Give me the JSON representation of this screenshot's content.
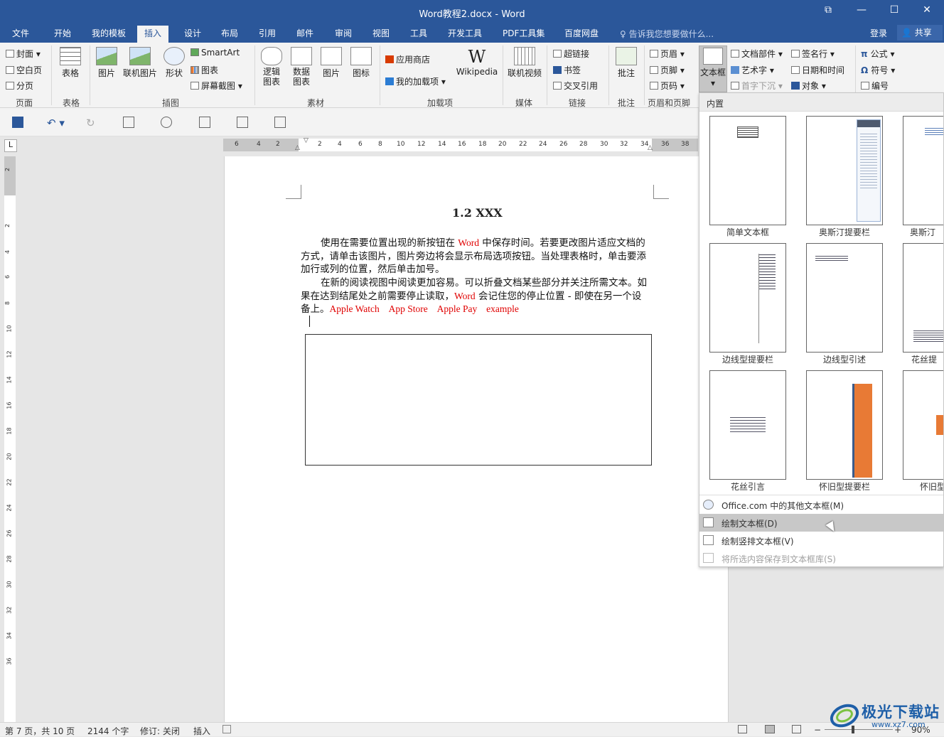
{
  "window": {
    "title": "Word教程2.docx - Word"
  },
  "menu": {
    "tabs": [
      "文件",
      "开始",
      "我的模板",
      "插入",
      "设计",
      "布局",
      "引用",
      "邮件",
      "审阅",
      "视图",
      "工具",
      "开发工具",
      "PDF工具集",
      "百度网盘"
    ],
    "active_tab": "插入",
    "tell_me": "告诉我您想要做什么...",
    "login": "登录",
    "share": "共享"
  },
  "ribbon": {
    "page_group": {
      "items": [
        "封面",
        "空白页",
        "分页"
      ],
      "label": "页面"
    },
    "table_group": {
      "button": "表格",
      "label": "表格"
    },
    "illustrations": {
      "picture": "图片",
      "online_picture": "联机图片",
      "shapes": "形状",
      "smartart": "SmartArt",
      "chart": "图表",
      "screenshot": "屏幕截图",
      "label": "插图"
    },
    "material": {
      "logic": [
        "逻辑",
        "图表"
      ],
      "data": [
        "数据",
        "图表"
      ],
      "picture": "图片",
      "icon": "图标",
      "label": "素材"
    },
    "addins": {
      "store": "应用商店",
      "my_addins": "我的加载项",
      "wikipedia": "Wikipedia",
      "label": "加载项"
    },
    "media": {
      "video": "联机视频",
      "label": "媒体"
    },
    "links": {
      "hyperlink": "超链接",
      "bookmark": "书签",
      "cross_ref": "交叉引用",
      "label": "链接"
    },
    "comments": {
      "comment": "批注",
      "label": "批注"
    },
    "header_footer": {
      "header": "页眉",
      "footer": "页脚",
      "page_number": "页码",
      "label": "页眉和页脚"
    },
    "text": {
      "textbox": "文本框",
      "parts": "文档部件",
      "wordart": "艺术字",
      "dropcap": "首字下沉",
      "signature": "签名行",
      "datetime": "日期和时间",
      "object": "对象"
    },
    "symbols": {
      "equation": "公式",
      "symbol": "符号",
      "number": "编号"
    }
  },
  "ruler": {
    "h_left": [
      "6",
      "4",
      "2"
    ],
    "h_main": [
      "2",
      "4",
      "6",
      "8",
      "10",
      "12",
      "14",
      "16",
      "18",
      "20",
      "22",
      "24",
      "26",
      "28",
      "30",
      "32",
      "34",
      "36",
      "38"
    ],
    "v": [
      "2",
      "2",
      "4",
      "6",
      "8",
      "10",
      "12",
      "14",
      "16",
      "18",
      "20",
      "22",
      "24",
      "26",
      "28",
      "30",
      "32",
      "34",
      "36"
    ],
    "corner": "L"
  },
  "document": {
    "heading": "1.2 XXX",
    "p1": {
      "a": "使用在需要位置出现的新按钮在 ",
      "word": "Word",
      "b": " 中保存时间。若要更改图片适应文档的方式，请单击该图片，图片旁边将会显示布局选项按钮。当处理表格时，单击要添加行或列的位置，然后单击加号。"
    },
    "p2": {
      "a": "在新的阅读视图中阅读更加容易。可以折叠文档某些部分并关注所需文本。如果在达到结尾处之前需要停止读取，",
      "word": "Word",
      "b": " 会记住您的停止位置 - 即使在另一个设备上。",
      "r1": "Apple Watch",
      "r2": "App Store",
      "r3": "Apple Pay",
      "r4": "example"
    }
  },
  "gallery": {
    "header": "内置",
    "captions": [
      "简单文本框",
      "奥斯汀提要栏",
      "奥斯汀",
      "边线型提要栏",
      "边线型引述",
      "花丝提",
      "花丝引言",
      "怀旧型提要栏",
      "怀旧型"
    ],
    "menu": [
      "Office.com 中的其他文本框(M)",
      "绘制文本框(D)",
      "绘制竖排文本框(V)",
      "将所选内容保存到文本框库(S)"
    ]
  },
  "status": {
    "page": "第 7 页，共 10 页",
    "words": "2144 个字",
    "track": "修订: 关闭",
    "mode": "插入",
    "zoom": "90%"
  },
  "watermark": {
    "text": "极光下载站",
    "url": "www.xz7.com"
  },
  "colors": {
    "brand": "#2b579a",
    "red_text": "#e00000",
    "orange": "#e87a35"
  }
}
